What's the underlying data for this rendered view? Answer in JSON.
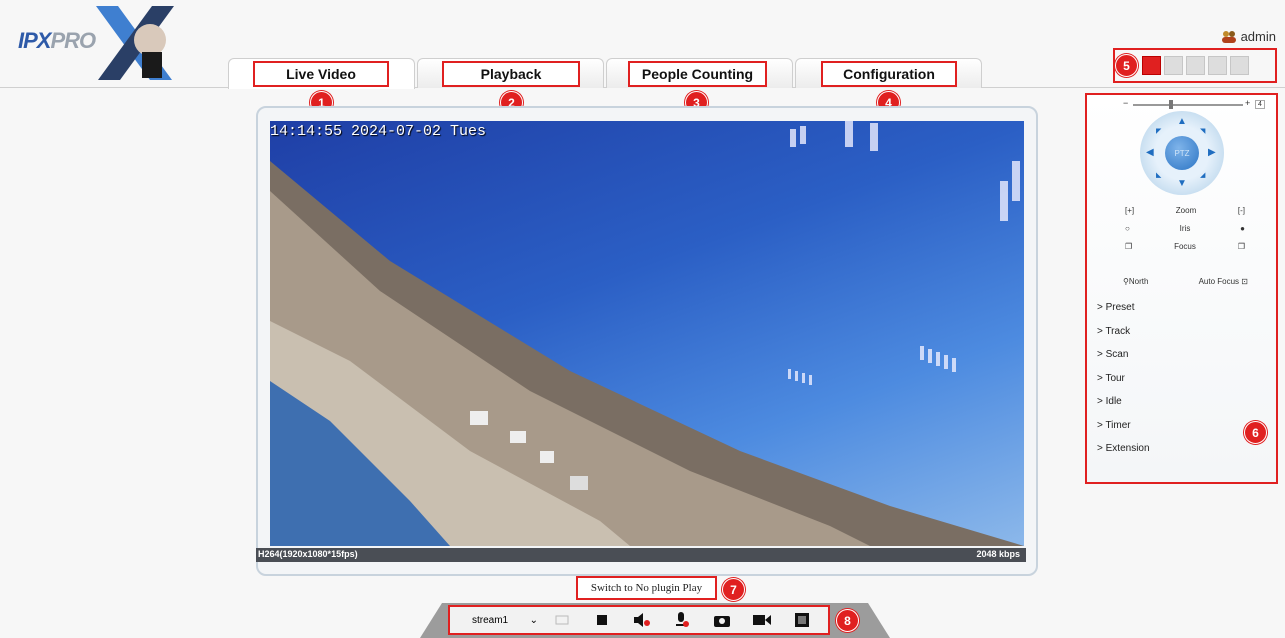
{
  "logo": {
    "text_a": "IPX",
    "text_b": "PRO"
  },
  "user": {
    "name": "admin"
  },
  "tabs": [
    {
      "label": "Live Video",
      "badge": "1"
    },
    {
      "label": "Playback",
      "badge": "2"
    },
    {
      "label": "People Counting",
      "badge": "3"
    },
    {
      "label": "Configuration",
      "badge": "4"
    }
  ],
  "badges": {
    "controls": "5",
    "ptz": "6",
    "switch": "7",
    "toolbar": "8"
  },
  "video": {
    "osd_time": "14:14:55 2024-07-02 Tues",
    "codec_info": "H264(1920x1080*15fps)",
    "bitrate": "2048 kbps"
  },
  "switch_label": "Switch to No plugin Play",
  "toolbar": {
    "stream_value": "stream1",
    "icons": [
      "ratio-icon",
      "stop-icon",
      "audio-icon",
      "mic-icon",
      "snapshot-icon",
      "record-icon",
      "fullscreen-icon"
    ]
  },
  "ptz": {
    "speed_value": "4",
    "center_label": "PTZ",
    "zoom_label": "Zoom",
    "iris_label": "Iris",
    "focus_label": "Focus",
    "north_label": "North",
    "autofocus_label": "Auto Focus",
    "menu": [
      "> Preset",
      "> Track",
      "> Scan",
      "> Tour",
      "> Idle",
      "> Timer",
      "> Extension"
    ]
  },
  "colors": {
    "accent_red": "#e02020",
    "logo_blue": "#2e5aa8",
    "sky_blue": "#2b5fc5"
  }
}
